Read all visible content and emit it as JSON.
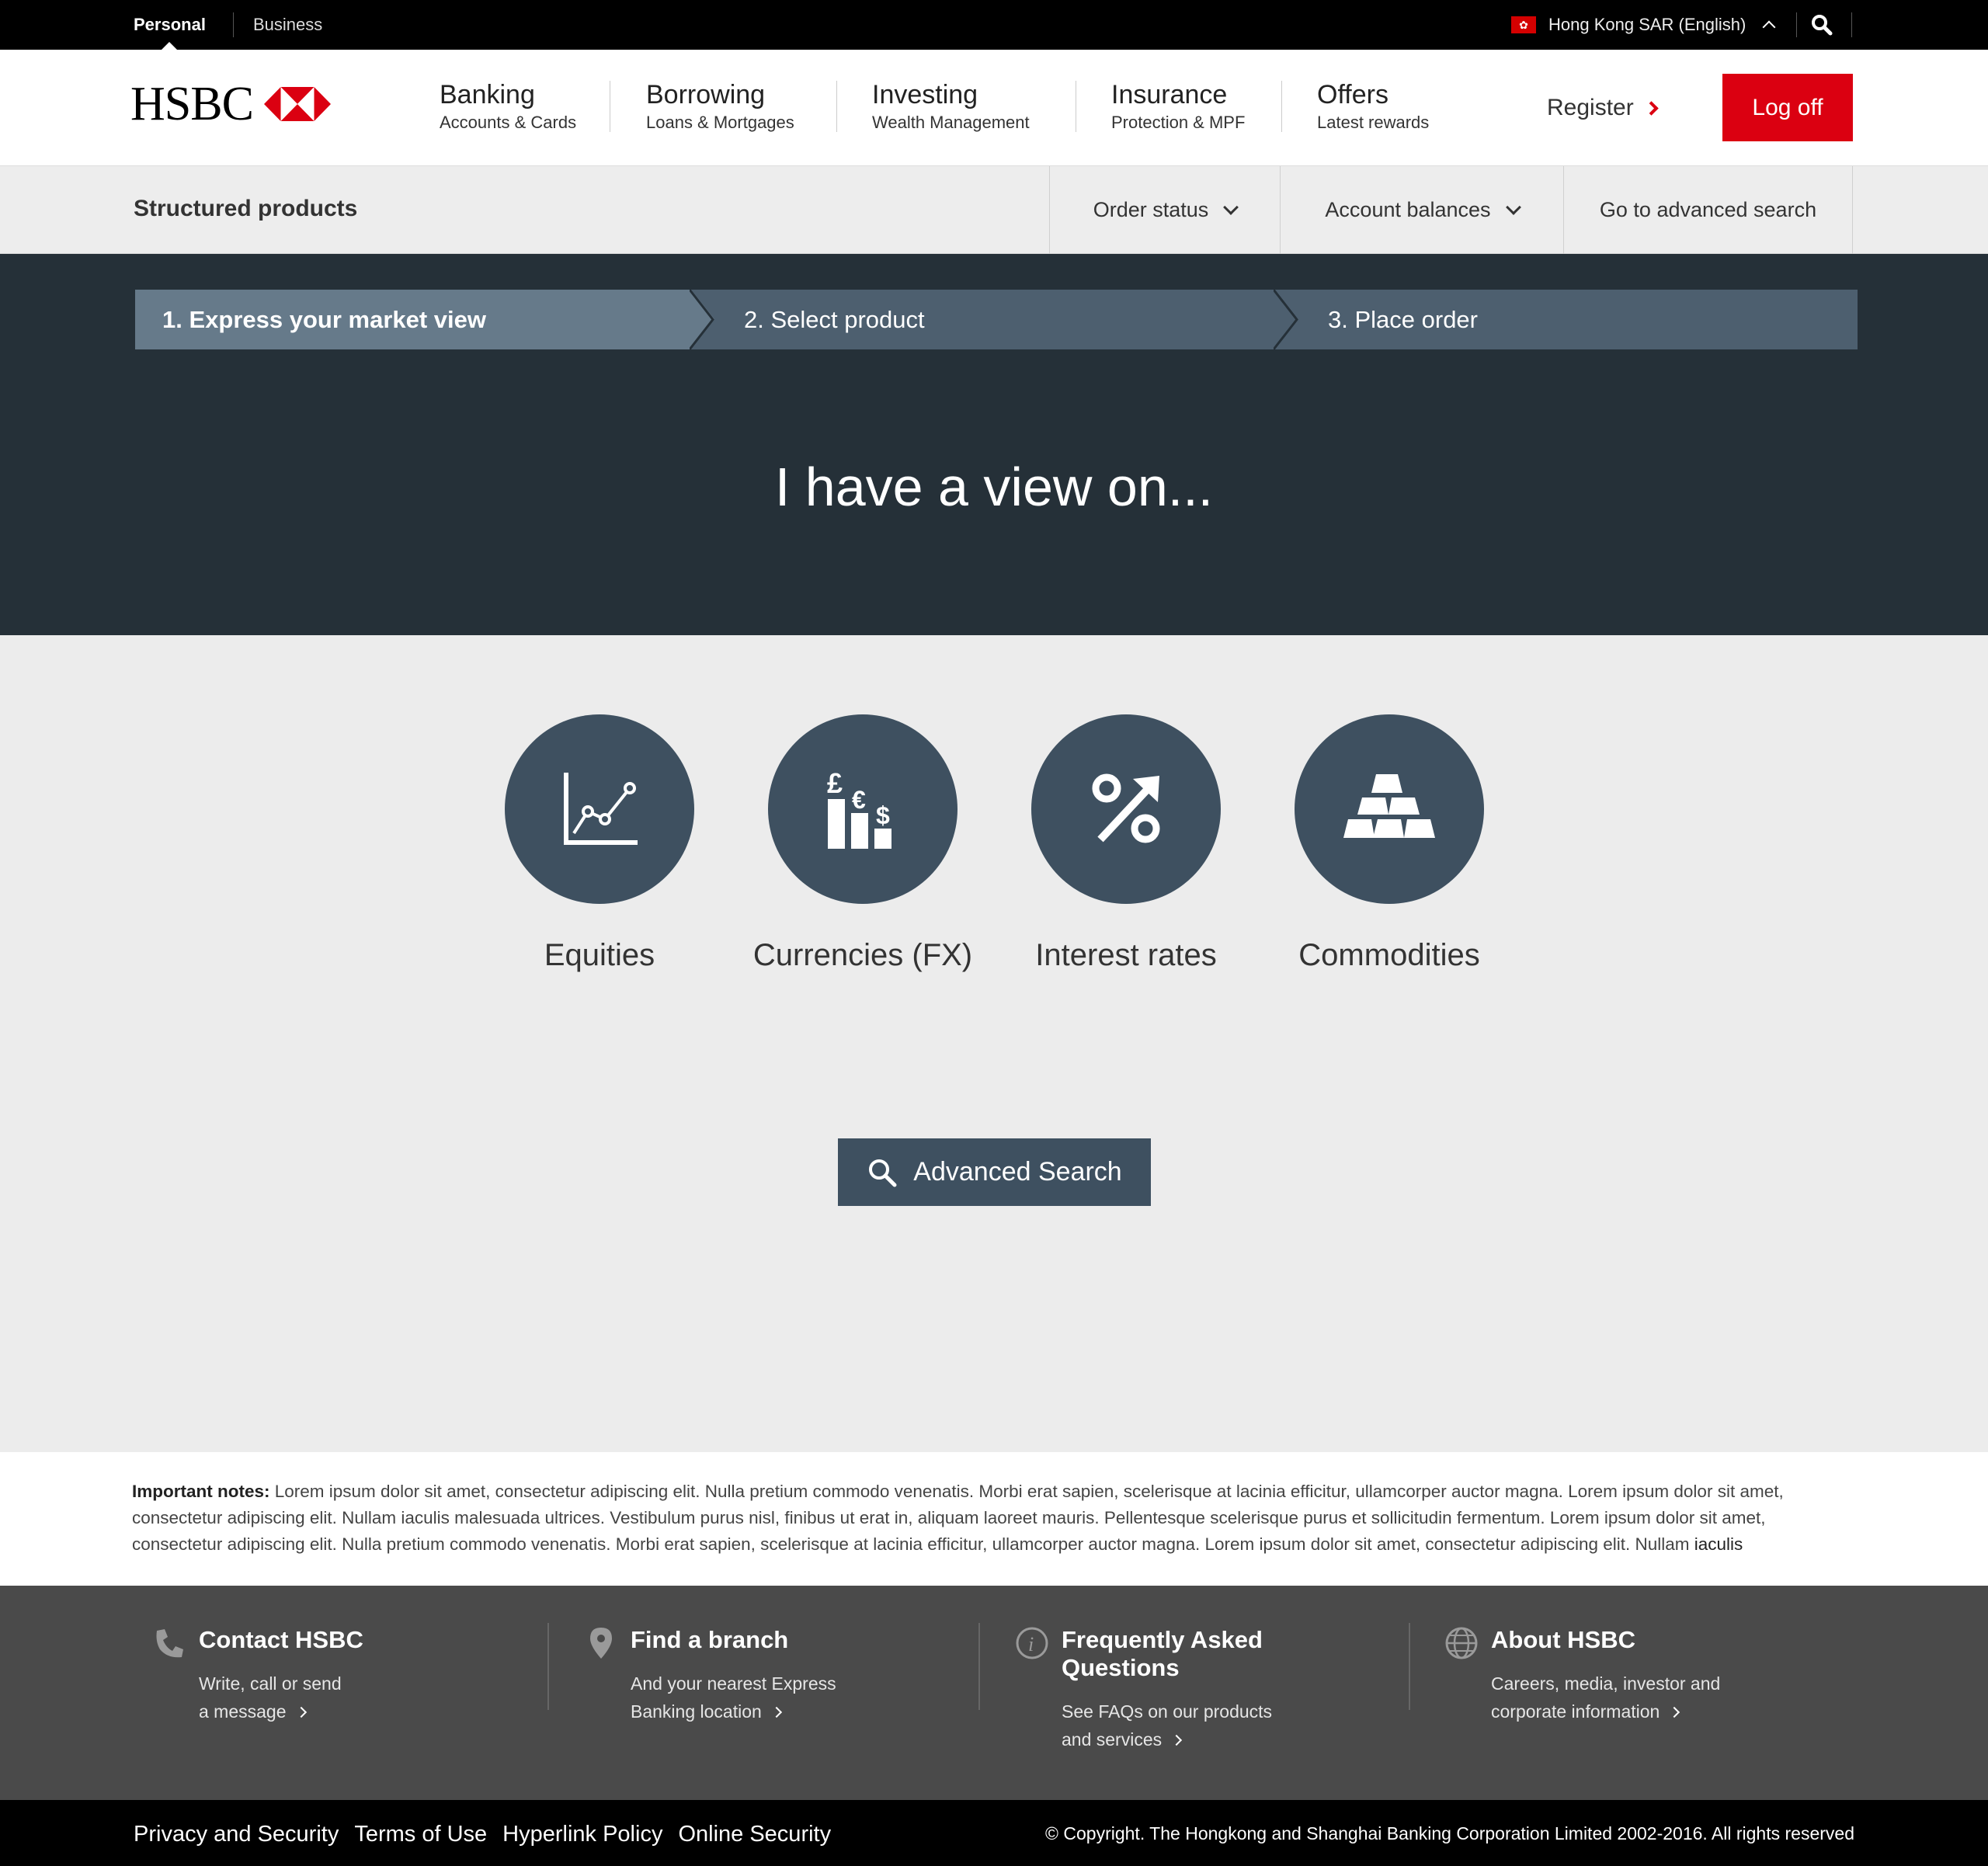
{
  "topbar": {
    "personal": "Personal",
    "business": "Business",
    "region": "Hong Kong SAR (English)"
  },
  "header": {
    "logo_text": "HSBC",
    "nav": [
      {
        "title": "Banking",
        "sub": "Accounts & Cards"
      },
      {
        "title": "Borrowing",
        "sub": "Loans & Mortgages"
      },
      {
        "title": "Investing",
        "sub": "Wealth Management"
      },
      {
        "title": "Insurance",
        "sub": "Protection & MPF"
      },
      {
        "title": "Offers",
        "sub": "Latest rewards"
      }
    ],
    "register": "Register",
    "logoff": "Log off"
  },
  "subnav": {
    "title": "Structured products",
    "order_status": "Order status",
    "account_balances": "Account balances",
    "advanced_search": "Go to advanced search"
  },
  "steps": [
    {
      "label": "1. Express your market view"
    },
    {
      "label": "2. Select product"
    },
    {
      "label": "3. Place order"
    }
  ],
  "hero": {
    "title": "I have a view on..."
  },
  "categories": [
    {
      "label": "Equities",
      "icon": "line-chart-icon"
    },
    {
      "label": "Currencies (FX)",
      "icon": "currency-icon"
    },
    {
      "label": "Interest rates",
      "icon": "percent-arrow-icon"
    },
    {
      "label": "Commodities",
      "icon": "gold-bars-icon"
    }
  ],
  "currency_symbols": {
    "pound": "£",
    "euro": "€",
    "dollar": "$"
  },
  "advanced_search_button": "Advanced Search",
  "notes": {
    "label": "Important notes:",
    "text": " Lorem ipsum dolor sit amet, consectetur adipiscing elit. Nulla pretium commodo venenatis. Morbi erat sapien, scelerisque at lacinia efficitur, ullamcorper auctor magna. Lorem ipsum dolor sit amet, consectetur adipiscing elit. Nullam iaculis malesuada ultrices. Vestibulum purus nisl, finibus ut erat in, aliquam laoreet mauris. Pellentesque scelerisque purus et sollicitudin fermentum. Lorem ipsum dolor sit amet, consectetur adipiscing elit. Nulla pretium commodo venenatis. Morbi erat sapien, scelerisque at lacinia efficitur, ullamcorper auctor magna. Lorem ipsum dolor sit amet, consectetur adipiscing elit. Nullam ",
    "tail": "iaculis"
  },
  "footer": {
    "contact": {
      "title": "Contact HSBC",
      "line1": "Write, call or send",
      "line2": "a message"
    },
    "branch": {
      "title": "Find a branch",
      "line1": "And your nearest Express",
      "line2": "Banking location"
    },
    "faq": {
      "title1": "Frequently Asked",
      "title2": "Questions",
      "line1": "See FAQs on our products",
      "line2": "and services"
    },
    "about": {
      "title": "About HSBC",
      "line1": "Careers, media, investor and",
      "line2": "corporate information"
    }
  },
  "bottom": {
    "links": [
      "Privacy and Security",
      "Terms of Use",
      "Hyperlink Policy",
      "Online Security"
    ],
    "copyright": "© Copyright. The Hongkong and Shanghai Banking Corporation Limited 2002-2016. All rights reserved"
  },
  "colors": {
    "brand_red": "#db0011",
    "hero_bg": "#253038",
    "slate": "#3e5060",
    "step_active": "#667a8a",
    "step_inactive": "#4d5f6f",
    "footer_bg": "#4a4a4a"
  }
}
